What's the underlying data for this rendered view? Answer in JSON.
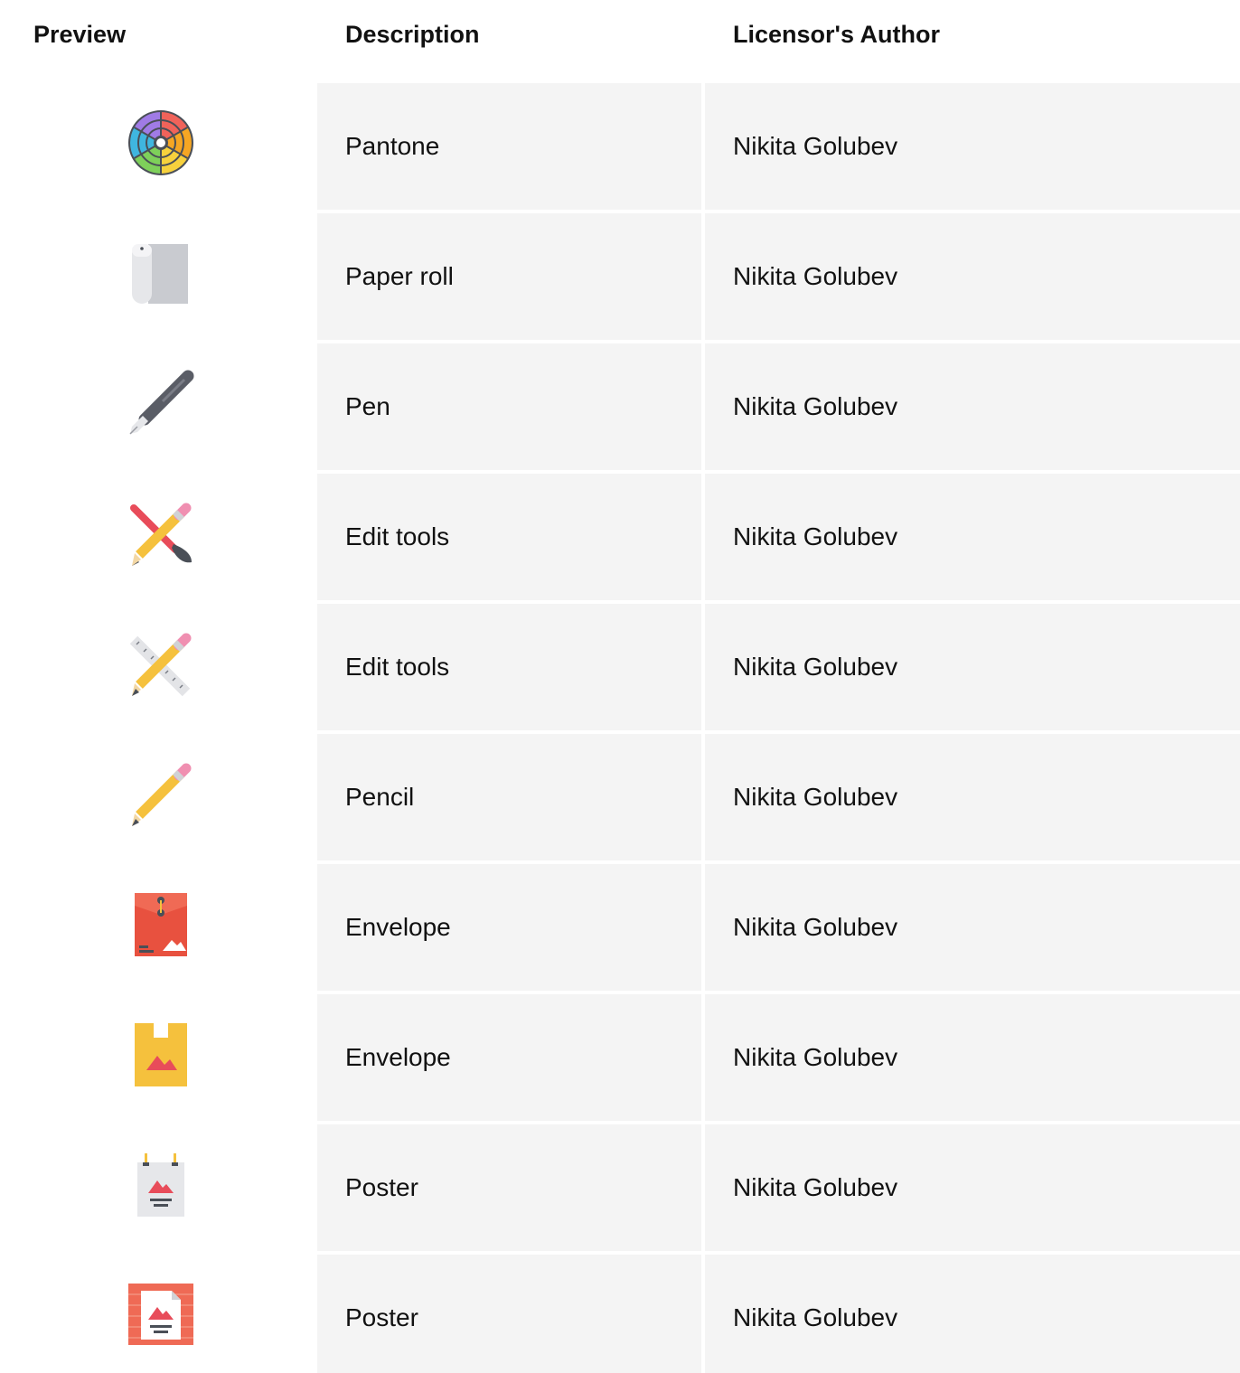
{
  "headers": {
    "preview": "Preview",
    "description": "Description",
    "author": "Licensor's Author"
  },
  "rows": [
    {
      "icon": "pantone-color-wheel-icon",
      "description": "Pantone",
      "author": "Nikita Golubev"
    },
    {
      "icon": "paper-roll-icon",
      "description": "Paper roll",
      "author": "Nikita Golubev"
    },
    {
      "icon": "pen-icon",
      "description": "Pen",
      "author": "Nikita Golubev"
    },
    {
      "icon": "pencil-and-brush-icon",
      "description": "Edit tools",
      "author": "Nikita Golubev"
    },
    {
      "icon": "pencil-and-ruler-icon",
      "description": "Edit tools",
      "author": "Nikita Golubev"
    },
    {
      "icon": "pencil-icon",
      "description": "Pencil",
      "author": "Nikita Golubev"
    },
    {
      "icon": "red-envelope-icon",
      "description": "Envelope",
      "author": "Nikita Golubev"
    },
    {
      "icon": "yellow-envelope-icon",
      "description": "Envelope",
      "author": "Nikita Golubev"
    },
    {
      "icon": "hanging-poster-icon",
      "description": "Poster",
      "author": "Nikita Golubev"
    },
    {
      "icon": "brick-wall-poster-icon",
      "description": "Poster",
      "author": "Nikita Golubev"
    }
  ],
  "colors": {
    "cell_background": "#f4f4f4",
    "page_background": "#ffffff",
    "text": "#111111"
  }
}
